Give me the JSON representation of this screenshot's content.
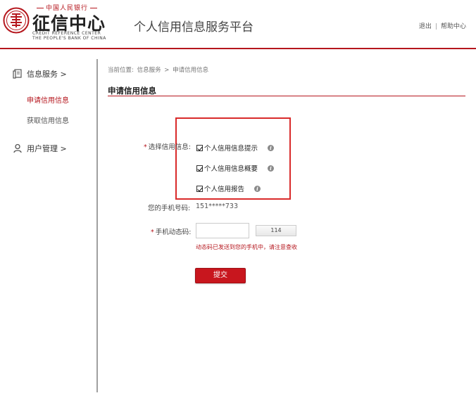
{
  "header": {
    "logo_top": "中国人民银行",
    "logo_main": "征信中心",
    "logo_en_line1": "CREDIT REFERENCE CENTER",
    "logo_en_line2": "THE PEOPLE'S BANK OF CHINA",
    "platform_title": "个人信用信息服务平台",
    "logout_label": "退出",
    "link_separator": "|",
    "help_label": "帮助中心"
  },
  "sidebar": {
    "sections": [
      {
        "label": "信息服务 >",
        "icon": "document-icon"
      },
      {
        "label": "用户管理 >",
        "icon": "user-icon"
      }
    ],
    "items": [
      {
        "label": "申请信用信息",
        "active": true
      },
      {
        "label": "获取信用信息",
        "active": false
      }
    ]
  },
  "breadcrumb": {
    "prefix": "当前位置:",
    "level1": "信息服务",
    "separator": ">",
    "level2": "申请信用信息"
  },
  "main": {
    "section_title": "申请信用信息",
    "select_label_required": "*",
    "select_label": "选择信用信息:",
    "options": [
      {
        "label": "个人信用信息提示",
        "checked": true
      },
      {
        "label": "个人信用信息概要",
        "checked": true
      },
      {
        "label": "个人信用报告",
        "checked": true
      }
    ],
    "phone_label": "您的手机号码:",
    "phone_value": "151*****733",
    "code_label_required": "*",
    "code_label": "手机动态码:",
    "code_input_value": "",
    "code_button_label": "114",
    "notice": "动态码已发送到您的手机中，请注意查收",
    "submit_label": "提交"
  },
  "colors": {
    "accent": "#b5161d",
    "highlight_border": "#d92a2a",
    "submit_bg": "#c8161e"
  }
}
